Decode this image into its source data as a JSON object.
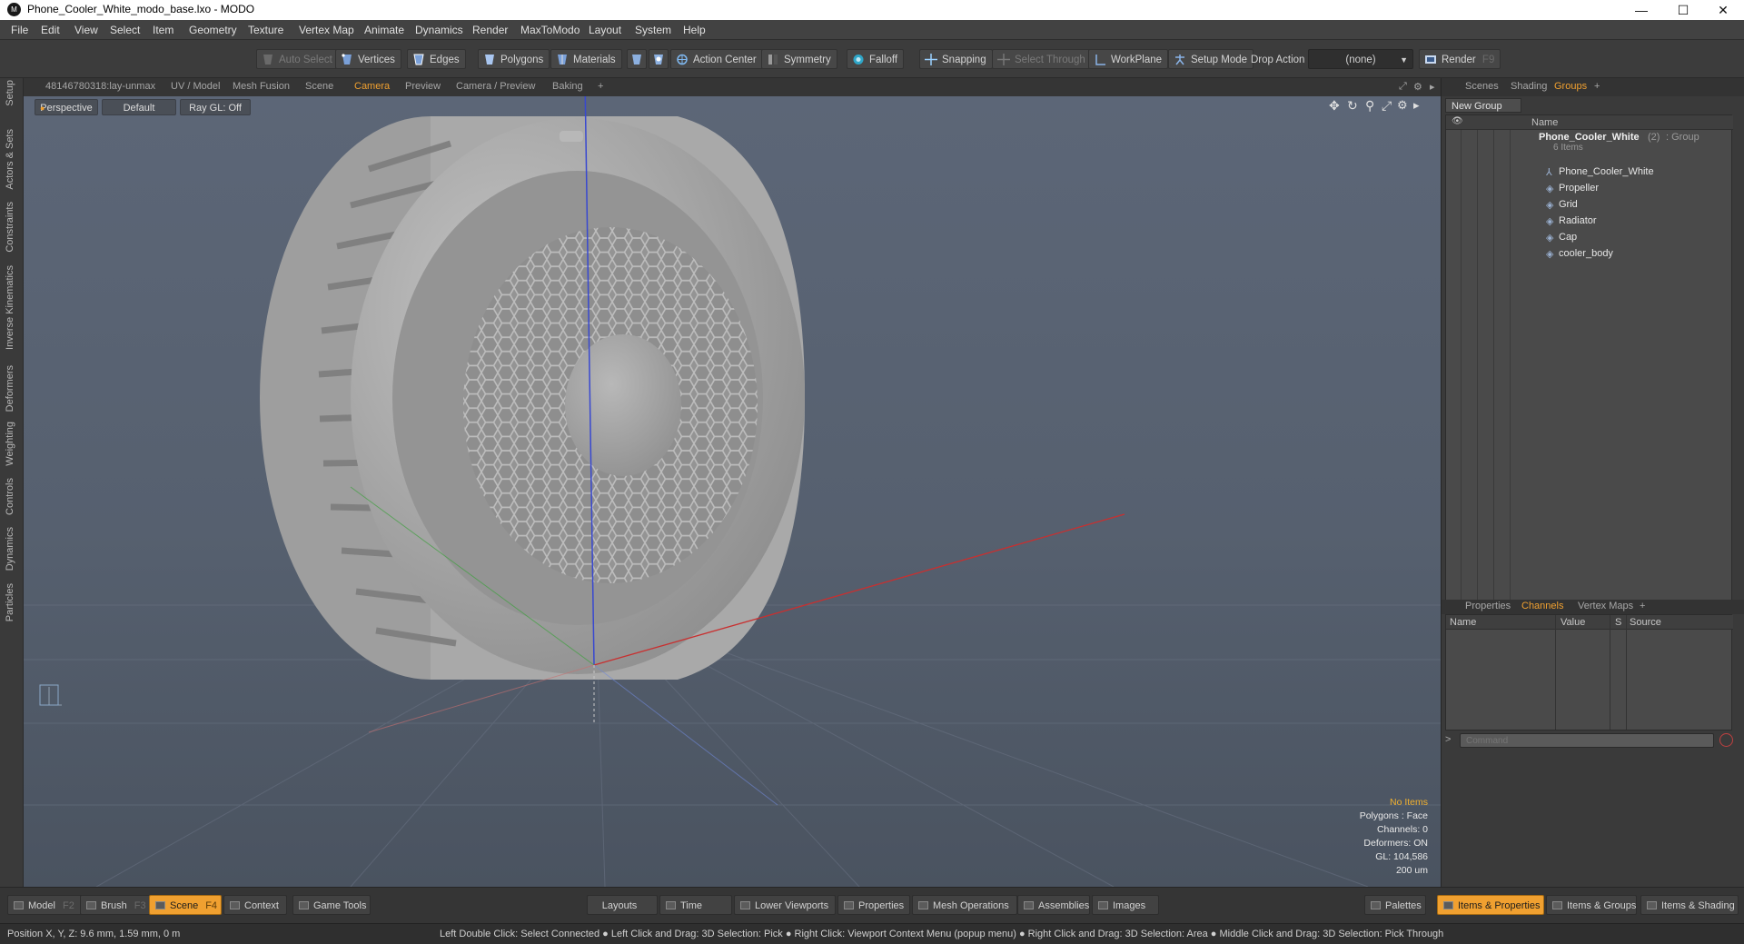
{
  "window": {
    "title": "Phone_Cooler_White_modo_base.lxo - MODO",
    "logo": "M",
    "controls": [
      "—",
      "☐",
      "✕"
    ]
  },
  "menu": [
    "File",
    "Edit",
    "View",
    "Select",
    "Item",
    "Geometry",
    "Texture",
    "Vertex Map",
    "Animate",
    "Dynamics",
    "Render",
    "MaxToModo",
    "Layout",
    "System",
    "Help"
  ],
  "toolbar": {
    "auto_select": "Auto Select",
    "vertices": "Vertices",
    "edges": "Edges",
    "polygons": "Polygons",
    "materials": "Materials",
    "action_center": "Action Center",
    "symmetry": "Symmetry",
    "falloff": "Falloff",
    "snapping": "Snapping",
    "select_through": "Select Through",
    "workplane": "WorkPlane",
    "setup_mode": "Setup Mode",
    "drop_action": "Drop Action",
    "drop_value": "(none)",
    "render": "Render",
    "render_key": "F9"
  },
  "left_tabs": [
    "Setup",
    "Actors & Sets",
    "Constraints",
    "Inverse Kinematics",
    "Deformers",
    "Weighting",
    "Controls",
    "Dynamics",
    "Particles"
  ],
  "viewport_tabs": [
    "48146780318:lay-unmax",
    "UV / Model",
    "Mesh Fusion",
    "Scene",
    "Camera",
    "Preview",
    "Camera / Preview",
    "Baking",
    "+"
  ],
  "viewport": {
    "view": "Perspective",
    "shading": "Default",
    "raygl": "Ray GL: Off",
    "hud": {
      "items": "No Items",
      "polygons": "Polygons : Face",
      "channels": "Channels: 0",
      "deformers": "Deformers: ON",
      "gl": "GL: 104,586",
      "scale": "200 um"
    }
  },
  "right_panel": {
    "tabs": [
      "Scenes",
      "Shading",
      "Groups",
      "+"
    ],
    "new_group": "New Group",
    "tree_header": "Name",
    "group_name": "Phone_Cooler_White",
    "group_count": "(2)",
    "group_type": ": Group",
    "group_items": "6 Items",
    "items": [
      "Phone_Cooler_White",
      "Propeller",
      "Grid",
      "Radiator",
      "Cap",
      "cooler_body"
    ],
    "lower_tabs": [
      "Properties",
      "Channels",
      "Vertex Maps",
      "+"
    ],
    "channel_cols": [
      "Name",
      "Value",
      "S",
      "Source"
    ],
    "command_placeholder": "Command"
  },
  "bottom": {
    "left_buttons": [
      {
        "label": "Model",
        "key": "F2"
      },
      {
        "label": "Brush",
        "key": "F3"
      },
      {
        "label": "Scene",
        "key": "F4"
      },
      {
        "label": "Context",
        "key": ""
      },
      {
        "label": "Game Tools",
        "key": ""
      }
    ],
    "mid_buttons": [
      "Layouts",
      "Time",
      "Lower Viewports",
      "Properties",
      "Mesh Operations",
      "Assemblies",
      "Images"
    ],
    "right_buttons": [
      "Palettes",
      "Items & Properties",
      "Items & Groups",
      "Items & Shading"
    ],
    "position": "Position X, Y, Z:  9.6 mm, 1.59 mm, 0 m",
    "hint": "Left Double Click: Select Connected ● Left Click and Drag: 3D Selection: Pick ● Right Click: Viewport Context Menu (popup menu) ● Right Click and Drag: 3D Selection: Area ● Middle Click and Drag: 3D Selection: Pick Through"
  },
  "colors": {
    "accent": "#f0a030",
    "viewport_bg": "#5a6474",
    "x_axis": "#c83030",
    "y_axis": "#3848d0",
    "z_axis": "#40a040"
  }
}
